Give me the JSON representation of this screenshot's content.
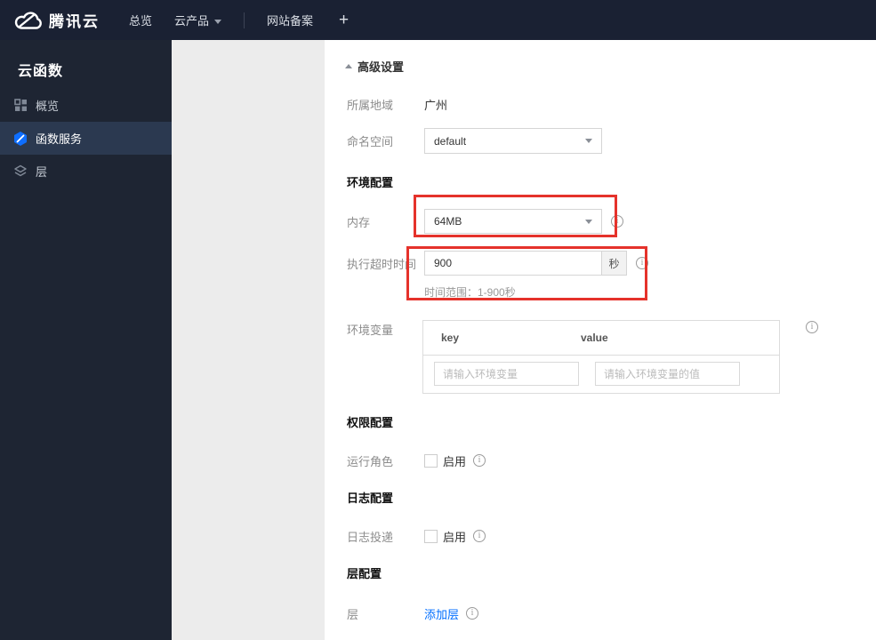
{
  "topbar": {
    "brand": "腾讯云",
    "nav_overview": "总览",
    "nav_products": "云产品",
    "nav_beian": "网站备案",
    "plus": "+"
  },
  "sidebar": {
    "title": "云函数",
    "items": [
      {
        "label": "概览",
        "icon": "grid-icon",
        "active": false
      },
      {
        "label": "函数服务",
        "icon": "function-hexagon-icon",
        "active": true
      },
      {
        "label": "层",
        "icon": "layers-icon",
        "active": false
      }
    ]
  },
  "main": {
    "advanced_settings": "高级设置",
    "region_label": "所属地域",
    "region_value": "广州",
    "namespace_label": "命名空间",
    "namespace_value": "default",
    "section_env": "环境配置",
    "memory_label": "内存",
    "memory_value": "64MB",
    "timeout_label": "执行超时时间",
    "timeout_value": "900",
    "timeout_unit": "秒",
    "timeout_hint": "时间范围：1-900秒",
    "envvar_label": "环境变量",
    "envvar_col_key": "key",
    "envvar_col_value": "value",
    "envvar_key_placeholder": "请输入环境变量",
    "envvar_value_placeholder": "请输入环境变量的值",
    "section_perm": "权限配置",
    "role_label": "运行角色",
    "role_enable": "启用",
    "section_log": "日志配置",
    "log_label": "日志投递",
    "log_enable": "启用",
    "section_layer": "层配置",
    "layer_label": "层",
    "layer_add": "添加层"
  },
  "colors": {
    "highlight_red": "#e5322b",
    "accent_blue": "#006eff",
    "topbar_bg": "#1a2133",
    "sidebar_bg": "#1e2533",
    "sidebar_active_bg": "#2b3950"
  }
}
